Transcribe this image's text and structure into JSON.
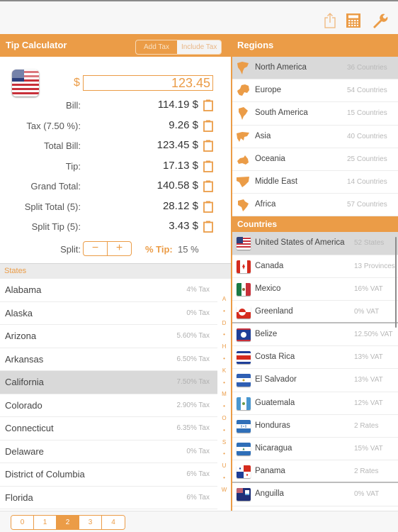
{
  "toolbar": {
    "icons": [
      "share-icon",
      "calculator-icon",
      "wrench-icon"
    ]
  },
  "calculator": {
    "title": "Tip Calculator",
    "tax_mode": {
      "options": [
        "Add Tax",
        "Include Tax"
      ],
      "selected": "Include Tax"
    },
    "flag": "us-flag-icon",
    "currency_symbol": "$",
    "amount": "123.45",
    "rows": [
      {
        "label": "Bill:",
        "value": "114.19 $"
      },
      {
        "label": "Tax (7.50 %):",
        "value": "9.26 $"
      },
      {
        "label": "Total Bill:",
        "value": "123.45 $"
      },
      {
        "label": "Tip:",
        "value": "17.13 $"
      },
      {
        "label": "Grand Total:",
        "value": "140.58 $"
      },
      {
        "label": "Split Total (5):",
        "value": "28.12 $"
      },
      {
        "label": "Split Tip (5):",
        "value": "3.43 $"
      }
    ],
    "split_label": "Split:",
    "split_minus": "−",
    "split_plus": "+",
    "tip_pct_label": "% Tip:",
    "tip_pct_value": "15 %"
  },
  "states": {
    "header": "States",
    "items": [
      {
        "name": "Alabama",
        "tax": "4% Tax"
      },
      {
        "name": "Alaska",
        "tax": "0% Tax"
      },
      {
        "name": "Arizona",
        "tax": "5.60% Tax"
      },
      {
        "name": "Arkansas",
        "tax": "6.50% Tax"
      },
      {
        "name": "California",
        "tax": "7.50% Tax",
        "selected": true
      },
      {
        "name": "Colorado",
        "tax": "2.90% Tax"
      },
      {
        "name": "Connecticut",
        "tax": "6.35% Tax"
      },
      {
        "name": "Delaware",
        "tax": "0% Tax"
      },
      {
        "name": "District of Columbia",
        "tax": "6% Tax"
      },
      {
        "name": "Florida",
        "tax": "6% Tax"
      }
    ],
    "index": [
      "A",
      "•",
      "D",
      "•",
      "H",
      "•",
      "K",
      "•",
      "M",
      "•",
      "O",
      "•",
      "S",
      "•",
      "U",
      "•",
      "W"
    ]
  },
  "tip_presets": {
    "options": [
      "0",
      "1",
      "2",
      "3",
      "4"
    ],
    "selected": "2"
  },
  "regions": {
    "header": "Regions",
    "items": [
      {
        "name": "North America",
        "count": "36 Countries",
        "icon": "north-america-icon",
        "selected": true
      },
      {
        "name": "Europe",
        "count": "54 Countries",
        "icon": "europe-icon"
      },
      {
        "name": "South America",
        "count": "15 Countries",
        "icon": "south-america-icon"
      },
      {
        "name": "Asia",
        "count": "40 Countries",
        "icon": "asia-icon"
      },
      {
        "name": "Oceania",
        "count": "25 Countries",
        "icon": "oceania-icon"
      },
      {
        "name": "Middle East",
        "count": "14 Countries",
        "icon": "middle-east-icon"
      },
      {
        "name": "Africa",
        "count": "57 Countries",
        "icon": "africa-icon"
      }
    ]
  },
  "countries": {
    "header": "Countries",
    "items": [
      {
        "name": "United States of America",
        "count": "52 States",
        "flag": "us",
        "selected": true
      },
      {
        "name": "Canada",
        "count": "13 Provinces",
        "flag": "ca"
      },
      {
        "name": "Mexico",
        "count": "16% VAT",
        "flag": "mx"
      },
      {
        "name": "Greenland",
        "count": "0% VAT",
        "flag": "gl"
      },
      {
        "name": "Belize",
        "count": "12.50% VAT",
        "flag": "bz"
      },
      {
        "name": "Costa Rica",
        "count": "13% VAT",
        "flag": "cr"
      },
      {
        "name": "El Salvador",
        "count": "13% VAT",
        "flag": "sv"
      },
      {
        "name": "Guatemala",
        "count": "12% VAT",
        "flag": "gt"
      },
      {
        "name": "Honduras",
        "count": "2 Rates",
        "flag": "hn"
      },
      {
        "name": "Nicaragua",
        "count": "15% VAT",
        "flag": "ni"
      },
      {
        "name": "Panama",
        "count": "2 Rates",
        "flag": "pa"
      },
      {
        "name": "Anguilla",
        "count": "0% VAT",
        "flag": "ai"
      }
    ]
  },
  "colors": {
    "accent": "#eb9c47",
    "selected_row": "#d9d9d9"
  }
}
